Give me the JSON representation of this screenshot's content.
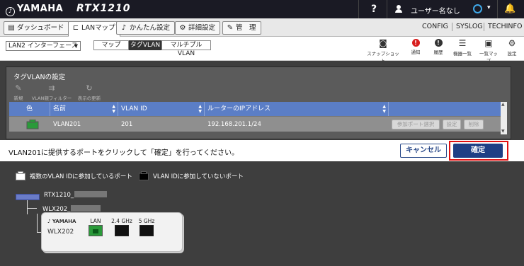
{
  "header": {
    "brand": "YAMAHA",
    "model": "RTX1210",
    "help": "?",
    "user_name": "ユーザー名なし",
    "caret": "▾",
    "bell": "🔔"
  },
  "tabs": [
    {
      "icon": "dashboard-icon",
      "label": "ダッシュボード"
    },
    {
      "icon": "lan-map-icon",
      "label": "LANマップ"
    },
    {
      "icon": "easy-setup-icon",
      "label": "かんたん設定"
    },
    {
      "icon": "advanced-settings-icon",
      "label": "詳細設定"
    },
    {
      "icon": "management-icon",
      "label": "管　理"
    }
  ],
  "top_links": [
    "CONFIG",
    "SYSLOG",
    "TECHINFO"
  ],
  "subbar": {
    "interface": "LAN2 インターフェース",
    "view_modes": [
      "マップ",
      "タグVLAN",
      "マルチプルVLAN"
    ],
    "selected_view": "タグVLAN",
    "tools": [
      {
        "icon": "camera-icon",
        "label": "スナップショット"
      },
      {
        "icon": "alert-icon",
        "label": "通知"
      },
      {
        "icon": "warning-icon",
        "label": "履歴"
      },
      {
        "icon": "device-list-icon",
        "label": "機器一覧"
      },
      {
        "icon": "map-list-icon",
        "label": "一覧マップ"
      },
      {
        "icon": "settings-icon",
        "label": "設定"
      }
    ]
  },
  "vlan_panel": {
    "title": "タグVLANの設定",
    "toolbar": [
      {
        "icon": "edit-icon",
        "label": "新規"
      },
      {
        "icon": "filter-icon",
        "label": "VLAN親フィルター"
      },
      {
        "icon": "refresh-icon",
        "label": "表示の更新"
      }
    ],
    "columns": [
      "色",
      "名前",
      "VLAN ID",
      "ルーターのIPアドレス"
    ],
    "rows": [
      {
        "name": "VLAN201",
        "vlan_id": "201",
        "ip": "192.168.201.1/24",
        "color": "#2a9a3a"
      }
    ],
    "row_buttons": [
      "参加ポート選択",
      "設定",
      "削除"
    ]
  },
  "notice": {
    "text": "VLAN201に提供するポートをクリックして「確定」を行ってください。",
    "cancel_label": "キャンセル",
    "confirm_label": "確定"
  },
  "legend": [
    {
      "label": "複数のVLAN IDに参加しているポート",
      "color": "#ffffff"
    },
    {
      "label": "VLAN IDに参加していないポート",
      "color": "#000000"
    }
  ],
  "devices": {
    "router_label": "RTX1210_",
    "ap_label": "WLX202_",
    "ap_brand": "YAMAHA",
    "ap_model": "WLX202",
    "ports": [
      "LAN",
      "2.4 GHz",
      "5 GHz"
    ]
  },
  "colors": {
    "accent": "#1f3f85",
    "highlight": "#e01010",
    "vlan_green": "#2a9a3a"
  }
}
